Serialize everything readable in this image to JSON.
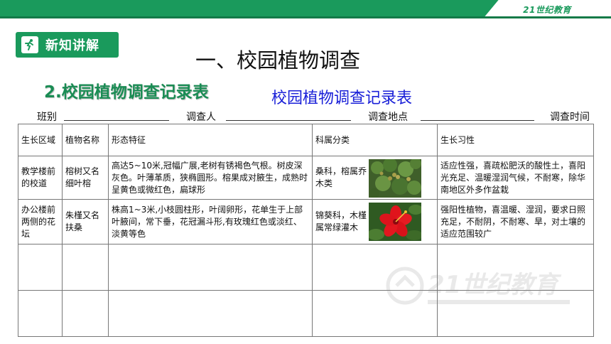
{
  "header": {
    "logo": "21世纪教育",
    "brand_color": "#1a9a5c"
  },
  "badge": {
    "label": "新知讲解",
    "icon": "runner-icon"
  },
  "main_title": "一、校园植物调查",
  "sub_title": "2.校园植物调查记录表",
  "table_title": "校园植物调查记录表",
  "info_fields": [
    "班别",
    "调查人",
    "调查地点",
    "调查时间"
  ],
  "table": {
    "headers": [
      "生长区域",
      "植物名称",
      "形态特征",
      "科属分类",
      "生长习性"
    ],
    "rows": [
      {
        "area": "教学楼前的校道",
        "name": "榕树又名细叶榕",
        "features": "高达5~10米,冠幅广展,老树有锈褐色气根。树皮深灰色。叶薄革质，狭椭圆形。榕果成对腋生，成熟时呈黄色或微红色，扁球形",
        "classification": "桑科，榕属乔木类",
        "habit": "适应性强，喜疏松肥沃的酸性土，喜阳光充足、温暖湿润气候，不耐寒，除华南地区外多作盆栽",
        "photo": "banyan-photo"
      },
      {
        "area": "办公楼前两侧的花坛",
        "name": "朱槿又名扶桑",
        "features": "株高1~3米,小枝圆柱形，叶阔卵形，花单生于上部叶腋间，常下垂，花冠漏斗形,有玫瑰红色或淡红、淡黄等色",
        "classification": "锦葵科，木槿属常绿灌木",
        "habit": "强阳性植物，喜温暖、湿润，要求日照充足，不耐阴，不耐寒、旱，对土壤的适应范围较广",
        "photo": "hibiscus-photo"
      }
    ]
  },
  "watermark": "21世纪教育"
}
